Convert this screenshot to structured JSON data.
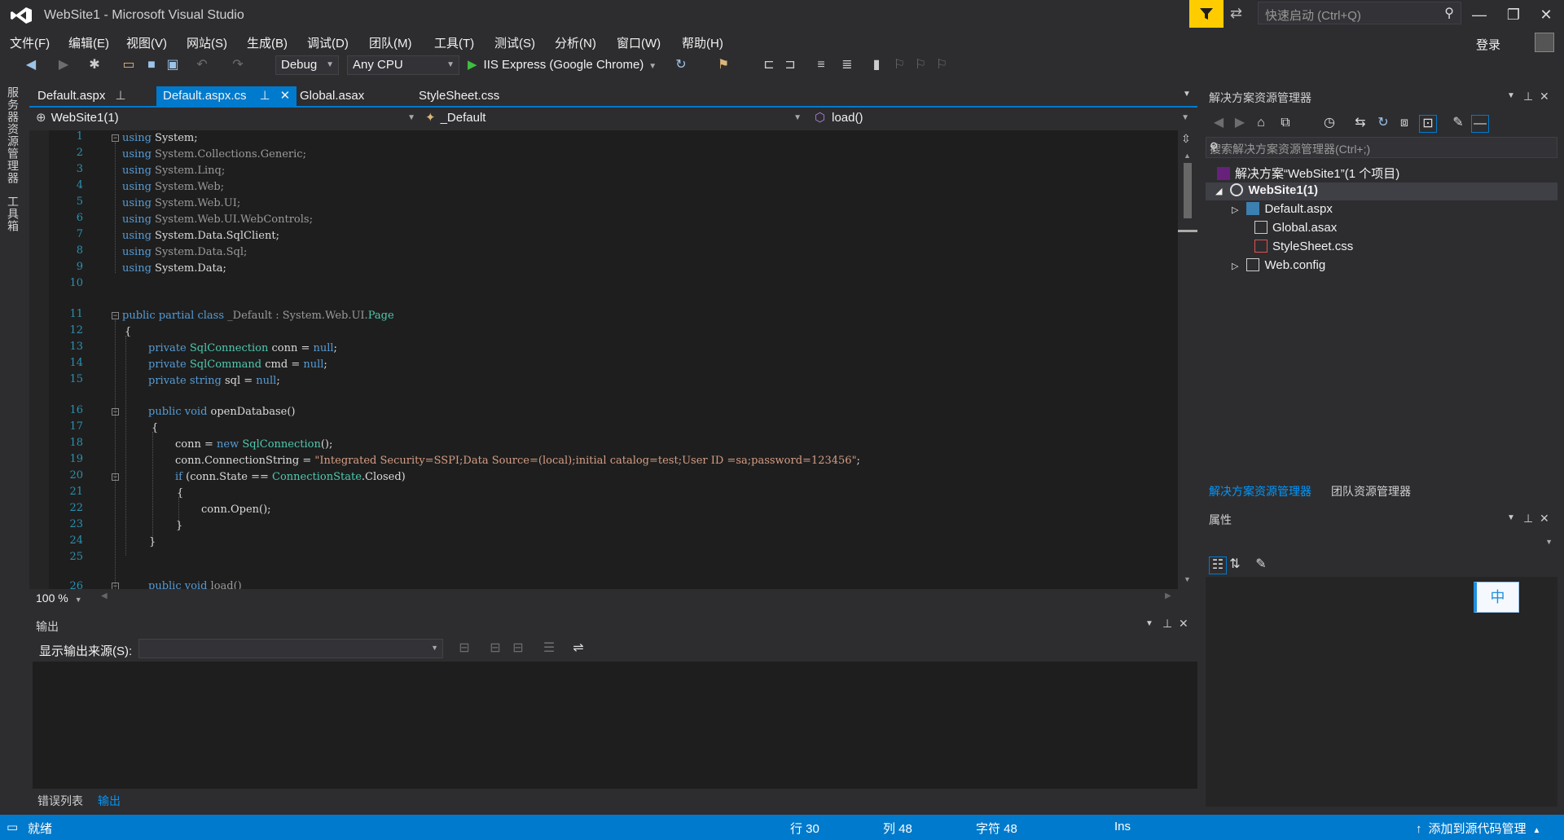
{
  "window": {
    "title": "WebSite1 - Microsoft Visual Studio"
  },
  "quick_launch": {
    "placeholder": "快速启动 (Ctrl+Q)"
  },
  "menu": [
    "文件(F)",
    "编辑(E)",
    "视图(V)",
    "网站(S)",
    "生成(B)",
    "调试(D)",
    "团队(M)",
    "工具(T)",
    "测试(S)",
    "分析(N)",
    "窗口(W)",
    "帮助(H)"
  ],
  "account": {
    "login": "登录"
  },
  "toolbar": {
    "config": "Debug",
    "platform": "Any CPU",
    "run": "IIS Express (Google Chrome)"
  },
  "side_tabs": [
    "服务器资源管理器",
    "工具箱"
  ],
  "doc_tabs": [
    {
      "label": "Default.aspx",
      "pinned": true
    },
    {
      "label": "Default.aspx.cs",
      "active": true,
      "pinned": true
    },
    {
      "label": "Global.asax"
    },
    {
      "label": "StyleSheet.css"
    }
  ],
  "nav": {
    "project": "WebSite1(1)",
    "class": "_Default",
    "member": "load()"
  },
  "code": {
    "line_numbers": [
      "1",
      "2",
      "3",
      "4",
      "5",
      "6",
      "7",
      "8",
      "9",
      "10",
      "11",
      "12",
      "13",
      "14",
      "15",
      "16",
      "17",
      "18",
      "19",
      "20",
      "21",
      "22",
      "23",
      "24",
      "25",
      "26"
    ],
    "using1": "System;",
    "using2": "System.Collections.Generic;",
    "using3": "System.Linq;",
    "using4": "System.Web;",
    "using5": "System.Web.UI;",
    "using6": "System.Web.UI.WebControls;",
    "using7": "System.Data.SqlClient;",
    "using8": "System.Data.Sql;",
    "using9": "System.Data;",
    "class_decl": "_Default : System.Web.UI.",
    "page_type": "Page",
    "conn_str": "\"Integrated Security=SSPI;Data Source=(local);initial catalog=test;User ID =sa;password=123456\""
  },
  "editor": {
    "zoom": "100 %"
  },
  "output": {
    "title": "输出",
    "source_label": "显示输出来源(S):",
    "source_value": ""
  },
  "bottom_tabs": [
    "错误列表",
    "输出"
  ],
  "solution_explorer": {
    "title": "解决方案资源管理器",
    "search_placeholder": "搜索解决方案资源管理器(Ctrl+;)",
    "solution": "解决方案“WebSite1”(1 个项目)",
    "project": "WebSite1(1)",
    "items": [
      "Default.aspx",
      "Global.asax",
      "StyleSheet.css",
      "Web.config"
    ],
    "tabs": [
      "解决方案资源管理器",
      "团队资源管理器"
    ]
  },
  "properties": {
    "title": "属性",
    "ime": "中"
  },
  "status": {
    "ready": "就绪",
    "line": "行 30",
    "col": "列 48",
    "char": "字符 48",
    "mode": "Ins",
    "source_control": "添加到源代码管理"
  },
  "colors": {
    "accent": "#007acc",
    "keyword": "#569cd6",
    "type": "#4ec9b0",
    "string": "#d69d85",
    "linenum": "#2b91af",
    "editor_bg": "#1e1e1e",
    "chrome_bg": "#2d2d30"
  }
}
